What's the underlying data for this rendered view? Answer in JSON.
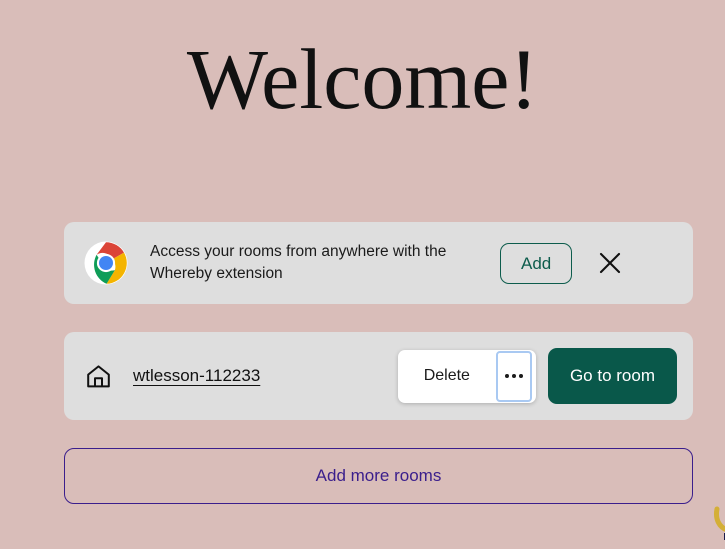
{
  "page": {
    "background_color": "#d9bdb9",
    "heading": "Welcome!"
  },
  "extension_banner": {
    "icon": "chrome-logo-icon",
    "message": "Access your rooms from anywhere with the Whereby extension",
    "add_label": "Add",
    "close_icon": "close-x-icon",
    "card_color": "#dedede",
    "accent_color": "#0d5c4c"
  },
  "room": {
    "icon": "home-icon",
    "name": "wtlesson-112233",
    "menu": {
      "delete_label": "Delete",
      "more_icon": "ellipsis-icon",
      "focus_color": "#a9c9f2"
    },
    "goto_label": "Go to room",
    "goto_color": "#09584a"
  },
  "actions": {
    "add_more_rooms_label": "Add more rooms",
    "add_more_rooms_color": "#3a1e8c"
  },
  "corner_widget": {
    "name": "support-widget-partial",
    "color": "#d4af37"
  }
}
